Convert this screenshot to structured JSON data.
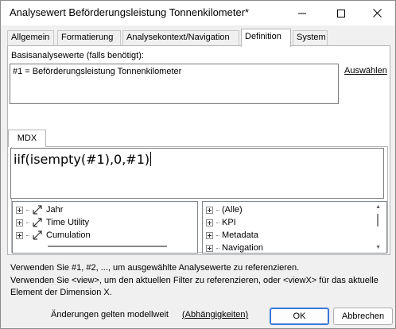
{
  "window": {
    "title": "Analysewert Beförderungsleistung Tonnenkilometer*"
  },
  "tabs": [
    {
      "label": "Allgemein"
    },
    {
      "label": "Formatierung"
    },
    {
      "label": "Analysekontext/Navigation"
    },
    {
      "label": "Definition"
    },
    {
      "label": "System"
    }
  ],
  "active_tab": "Definition",
  "definition": {
    "base_label": "Basisanalysewerte (falls benötigt):",
    "base_value": "#1 = Beförderungsleistung Tonnenkilometer",
    "select_link": "Auswählen",
    "mdx_tab_label": "MDX",
    "mdx_expression": "iif(isempty(#1),0,#1)"
  },
  "left_tree": {
    "items": [
      {
        "label": "Jahr",
        "icon": "dimension-icon"
      },
      {
        "label": "Time Utility",
        "icon": "dimension-icon"
      },
      {
        "label": "Cumulation",
        "icon": "dimension-icon"
      }
    ]
  },
  "right_tree": {
    "items": [
      {
        "label": "(Alle)"
      },
      {
        "label": "KPI"
      },
      {
        "label": "Metadata"
      },
      {
        "label": "Navigation"
      }
    ]
  },
  "info": {
    "line1": "Verwenden Sie #1, #2, ..., um ausgewählte Analysewerte zu referenzieren.",
    "line2": "Verwenden Sie <view>, um den aktuellen Filter zu referenzieren, oder <viewX> für das aktuelle",
    "line3": "Element der Dimension X."
  },
  "footer": {
    "model_note": "Änderungen gelten modellweit",
    "dependencies_link": "(Abhängigkeiten)",
    "ok_label": "OK",
    "cancel_label": "Abbrechen"
  }
}
